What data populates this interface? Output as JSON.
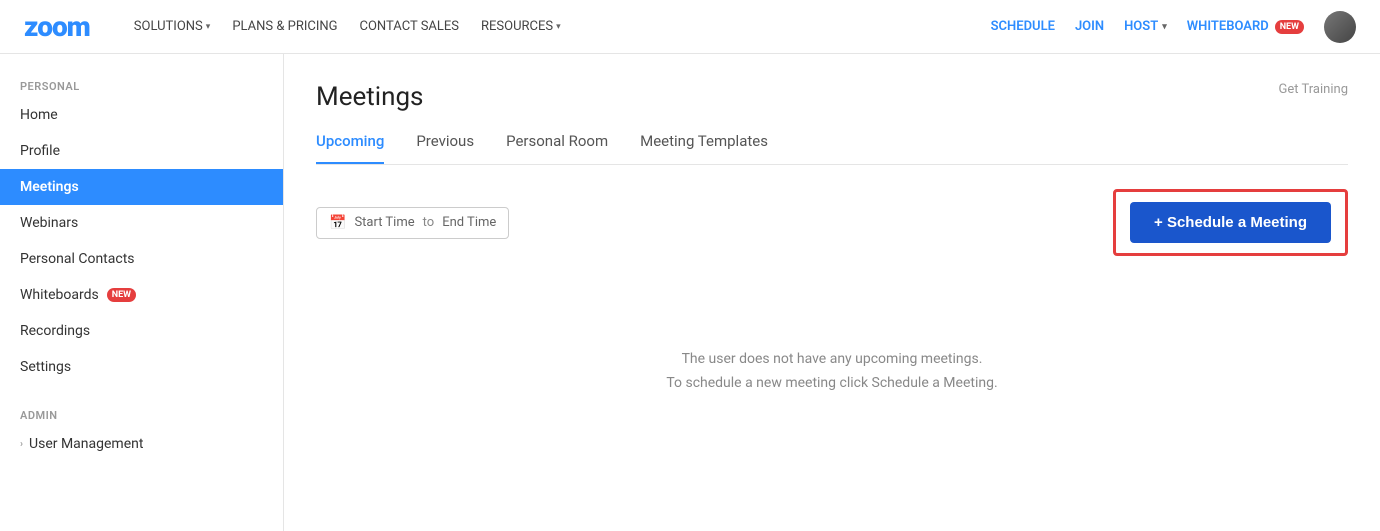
{
  "topnav": {
    "logo": "zoom",
    "nav_items": [
      {
        "label": "SOLUTIONS",
        "has_dropdown": true
      },
      {
        "label": "PLANS & PRICING",
        "has_dropdown": false
      },
      {
        "label": "CONTACT SALES",
        "has_dropdown": false
      },
      {
        "label": "RESOURCES",
        "has_dropdown": true
      }
    ],
    "actions": [
      {
        "id": "schedule",
        "label": "SCHEDULE"
      },
      {
        "id": "join",
        "label": "JOIN"
      },
      {
        "id": "host",
        "label": "HOST",
        "has_dropdown": true
      },
      {
        "id": "whiteboard",
        "label": "WHITEBOARD",
        "has_badge": true,
        "badge": "NEW"
      }
    ]
  },
  "sidebar": {
    "personal_label": "PERSONAL",
    "admin_label": "ADMIN",
    "personal_items": [
      {
        "id": "home",
        "label": "Home",
        "active": false
      },
      {
        "id": "profile",
        "label": "Profile",
        "active": false
      },
      {
        "id": "meetings",
        "label": "Meetings",
        "active": true
      },
      {
        "id": "webinars",
        "label": "Webinars",
        "active": false
      },
      {
        "id": "personal-contacts",
        "label": "Personal Contacts",
        "active": false
      },
      {
        "id": "whiteboards",
        "label": "Whiteboards",
        "active": false,
        "badge": "NEW"
      },
      {
        "id": "recordings",
        "label": "Recordings",
        "active": false
      },
      {
        "id": "settings",
        "label": "Settings",
        "active": false
      }
    ],
    "admin_items": [
      {
        "id": "user-management",
        "label": "User Management",
        "expandable": true
      }
    ]
  },
  "main": {
    "title": "Meetings",
    "get_training": "Get Training",
    "tabs": [
      {
        "id": "upcoming",
        "label": "Upcoming",
        "active": true
      },
      {
        "id": "previous",
        "label": "Previous",
        "active": false
      },
      {
        "id": "personal-room",
        "label": "Personal Room",
        "active": false
      },
      {
        "id": "meeting-templates",
        "label": "Meeting Templates",
        "active": false
      }
    ],
    "date_range": {
      "start_placeholder": "Start Time",
      "separator": "to",
      "end_placeholder": "End Time"
    },
    "schedule_button": "+ Schedule a Meeting",
    "empty_state_line1": "The user does not have any upcoming meetings.",
    "empty_state_line2": "To schedule a new meeting click Schedule a Meeting."
  }
}
